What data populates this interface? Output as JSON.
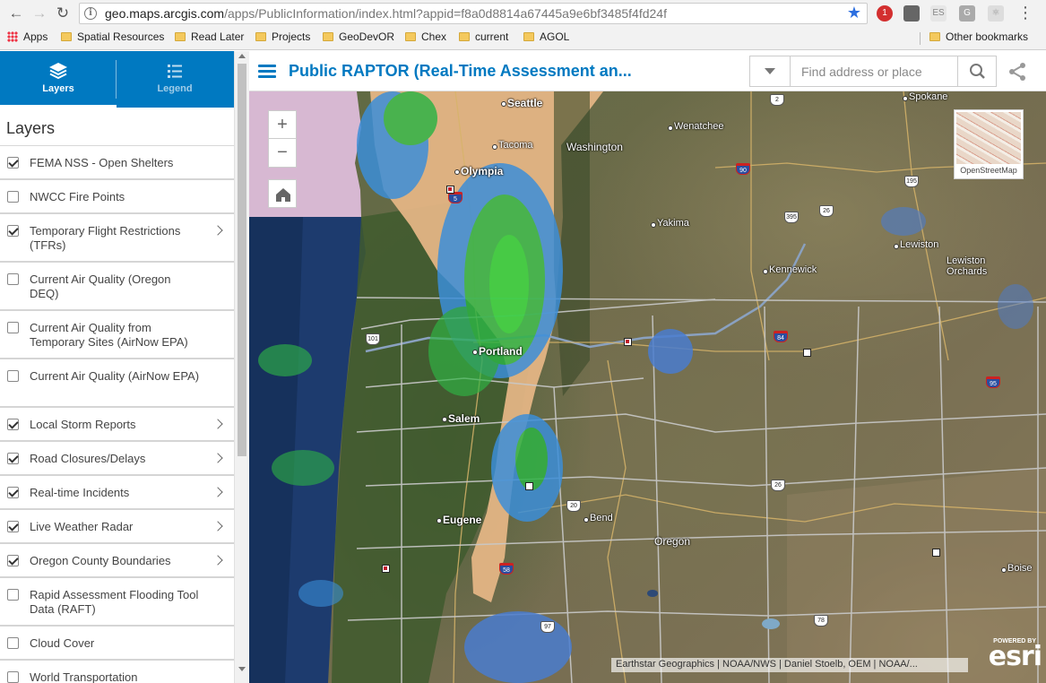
{
  "browser": {
    "url_host": "geo.maps.arcgis.com",
    "url_path": "/apps/PublicInformation/index.html?appid=f8a0d8814a67445a9e6bf3485f4fd24f",
    "extension_badge": "1",
    "extension_es": "ES",
    "extension_g": "G",
    "bookmarks": [
      "Apps",
      "Spatial Resources",
      "Read Later",
      "Projects",
      "GeoDevOR",
      "Chex",
      "current",
      "AGOL"
    ],
    "other_bookmarks": "Other bookmarks"
  },
  "panel": {
    "tabs": [
      {
        "label": "Layers",
        "icon": "layers-icon",
        "active": true
      },
      {
        "label": "Legend",
        "icon": "legend-icon",
        "active": false
      }
    ],
    "heading": "Layers",
    "layers": [
      {
        "label": "FEMA NSS - Open Shelters",
        "checked": true,
        "expandable": false
      },
      {
        "label": "NWCC Fire Points",
        "checked": false,
        "expandable": false
      },
      {
        "label": "Temporary Flight Restrictions (TFRs)",
        "checked": true,
        "expandable": true
      },
      {
        "label": "Current Air Quality (Oregon DEQ)",
        "checked": false,
        "expandable": false
      },
      {
        "label": "Current Air Quality from Temporary Sites (AirNow EPA)",
        "checked": false,
        "expandable": false
      },
      {
        "label": "Current Air Quality (AirNow EPA)",
        "checked": false,
        "expandable": false
      },
      {
        "label": "Local Storm Reports",
        "checked": true,
        "expandable": true
      },
      {
        "label": "Road Closures/Delays",
        "checked": true,
        "expandable": true
      },
      {
        "label": "Real-time Incidents",
        "checked": true,
        "expandable": true
      },
      {
        "label": "Live Weather Radar",
        "checked": true,
        "expandable": true
      },
      {
        "label": "Oregon County Boundaries",
        "checked": true,
        "expandable": true
      },
      {
        "label": "Rapid Assessment Flooding Tool Data (RAFT)",
        "checked": false,
        "expandable": false
      },
      {
        "label": "Cloud Cover",
        "checked": false,
        "expandable": false
      },
      {
        "label": "World Transportation",
        "checked": false,
        "expandable": false
      }
    ]
  },
  "header": {
    "title": "Public RAPTOR (Real-Time Assessment an...",
    "search_placeholder": "Find address or place"
  },
  "map": {
    "zoom_in": "+",
    "zoom_out": "−",
    "basemap_label": "OpenStreetMap",
    "cities": [
      {
        "name": "Seattle",
        "big": true
      },
      {
        "name": "Tacoma",
        "big": false
      },
      {
        "name": "Olympia",
        "big": true
      },
      {
        "name": "Washington",
        "big": false
      },
      {
        "name": "Wenatchee",
        "big": false
      },
      {
        "name": "Spokane",
        "big": false
      },
      {
        "name": "Yakima",
        "big": false
      },
      {
        "name": "Kennewick",
        "big": false
      },
      {
        "name": "Lewiston",
        "big": false
      },
      {
        "name": "Lewiston Orchards",
        "big": false
      },
      {
        "name": "Portland",
        "big": true
      },
      {
        "name": "Salem",
        "big": true
      },
      {
        "name": "Eugene",
        "big": true
      },
      {
        "name": "Bend",
        "big": false
      },
      {
        "name": "Oregon",
        "big": false
      },
      {
        "name": "Boise",
        "big": false
      }
    ],
    "shields": [
      "2",
      "90",
      "395",
      "195",
      "26",
      "84",
      "95",
      "5",
      "101",
      "20",
      "26",
      "58",
      "97",
      "78"
    ],
    "attribution": "Earthstar Geographics | NOAA/NWS | Daniel Stoelb, OEM | NOAA/...",
    "powered_by": "POWERED BY",
    "esri": "esri"
  }
}
